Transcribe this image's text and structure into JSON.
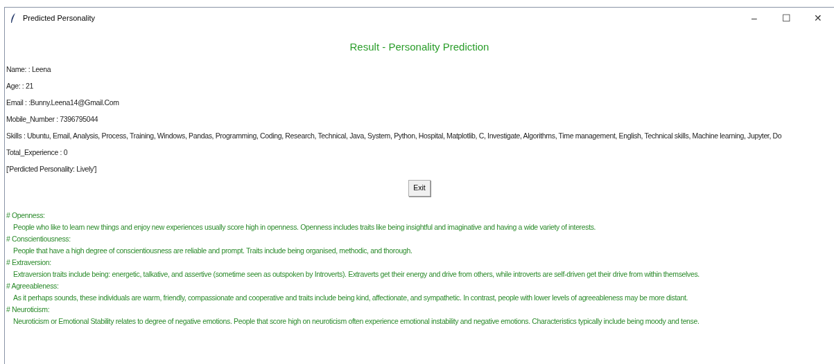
{
  "window": {
    "title": "Predicted Personality",
    "controls": [
      "–",
      "☐",
      "✕"
    ]
  },
  "heading": "Result - Personality Prediction",
  "fields": [
    "Name: : Leena",
    "Age: : 21",
    "Email : :Bunny.Leena14@Gmail.Com",
    "Mobile_Number : 7396795044",
    "Skills : Ubuntu, Email, Analysis, Process, Training, Windows, Pandas, Programming, Coding, Research, Technical, Java, System, Python, Hospital, Matplotlib, C, Investigate, Algorithms, Time management, English, Technical skills, Machine learning, Jupyter, Do",
    "Total_Experience : 0"
  ],
  "prediction": "['Perdicted Personality: Lively']",
  "exit_button": "Exit",
  "traits": [
    {
      "title": "# Openness:",
      "text": "People who like to learn new things and enjoy new experiences usually score high in openness. Openness includes traits like being insightful and imaginative and having a wide variety of interests."
    },
    {
      "title": "# Conscientiousness:",
      "text": "People that have a high degree of conscientiousness are reliable and prompt. Traits include being organised, methodic, and thorough."
    },
    {
      "title": "# Extraversion:",
      "text": "Extraversion traits include being: energetic, talkative, and assertive (sometime seen as outspoken by Introverts). Extraverts get their energy and drive from others, while introverts are self-driven get their drive from within themselves."
    },
    {
      "title": "# Agreeableness:",
      "text": "As it perhaps sounds, these individuals are warm, friendly, compassionate and cooperative and traits include being kind, affectionate, and sympathetic. In contrast, people with lower levels of agreeableness may be more distant."
    },
    {
      "title": "# Neuroticism:",
      "text": "Neuroticism or Emotional Stability relates to degree of negative emotions. People that score high on neuroticism often experience emotional instability and negative emotions. Characteristics typically include being moody and tense."
    }
  ]
}
